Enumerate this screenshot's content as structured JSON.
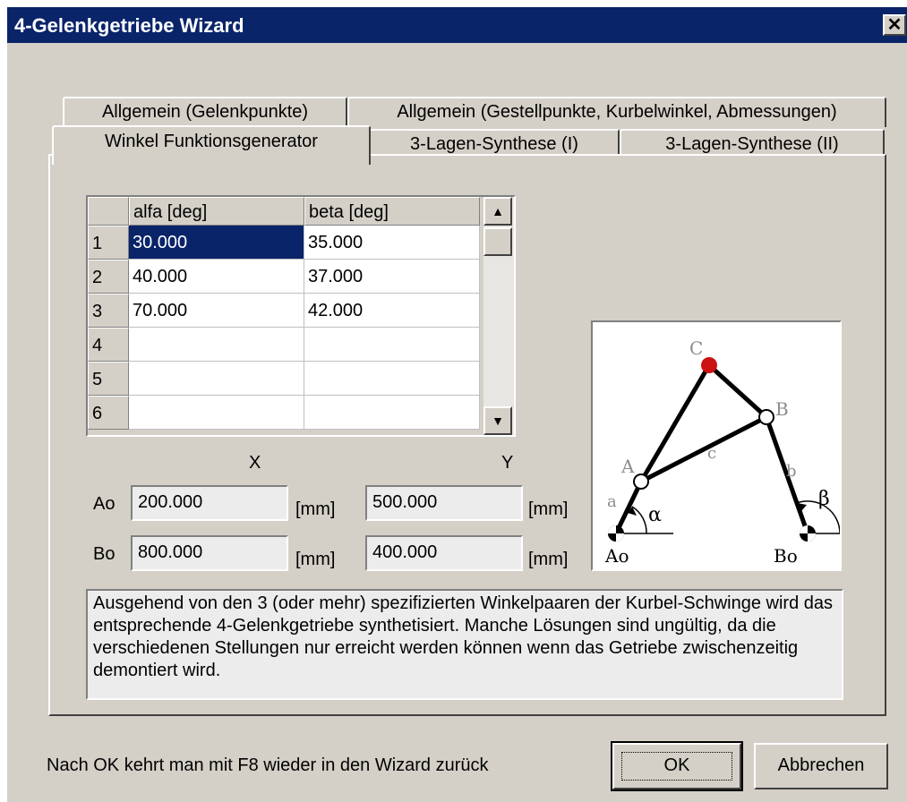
{
  "window": {
    "title": "4-Gelenkgetriebe Wizard",
    "close_glyph": "✕"
  },
  "tabs": {
    "back_row": [
      "Allgemein (Gelenkpunkte)",
      "Allgemein (Gestellpunkte, Kurbelwinkel, Abmessungen)"
    ],
    "front_row": [
      "Winkel Funktionsgenerator",
      "3-Lagen-Synthese (I)",
      "3-Lagen-Synthese (II)"
    ],
    "active": "Winkel Funktionsgenerator"
  },
  "grid": {
    "columns": [
      "alfa [deg]",
      "beta [deg]"
    ],
    "rows": [
      {
        "num": "1",
        "alfa": "30.000",
        "beta": "35.000"
      },
      {
        "num": "2",
        "alfa": "40.000",
        "beta": "37.000"
      },
      {
        "num": "3",
        "alfa": "70.000",
        "beta": "42.000"
      },
      {
        "num": "4",
        "alfa": "",
        "beta": ""
      },
      {
        "num": "5",
        "alfa": "",
        "beta": ""
      },
      {
        "num": "6",
        "alfa": "",
        "beta": ""
      }
    ],
    "selected_cell": "1-alfa"
  },
  "coords": {
    "x_header": "X",
    "y_header": "Y",
    "unit": "[mm]",
    "rows": [
      {
        "label": "Ao",
        "x": "200.000",
        "y": "500.000"
      },
      {
        "label": "Bo",
        "x": "800.000",
        "y": "400.000"
      }
    ]
  },
  "diagram": {
    "labels": {
      "C": "C",
      "B": "B",
      "A": "A",
      "a": "a",
      "b": "b",
      "c": "c",
      "alpha": "α",
      "beta": "β",
      "Ao": "Ao",
      "Bo": "Bo"
    },
    "joint_color": "#cc1111"
  },
  "description": "Ausgehend von den 3 (oder mehr) spezifizierten Winkelpaaren der Kurbel-Schwinge wird das entsprechende 4-Gelenkgetriebe synthetisiert. Manche Lösungen sind ungültig, da die verschiedenen Stellungen nur erreicht werden können wenn das Getriebe zwischenzeitig demontiert wird.",
  "footer": {
    "hint": "Nach OK kehrt man mit F8 wieder in den Wizard zurück",
    "ok_label": "OK",
    "cancel_label": "Abbrechen"
  },
  "colors": {
    "titlebar": "#0a246a",
    "dialog": "#d4d0c8",
    "selection": "#0a246a"
  }
}
